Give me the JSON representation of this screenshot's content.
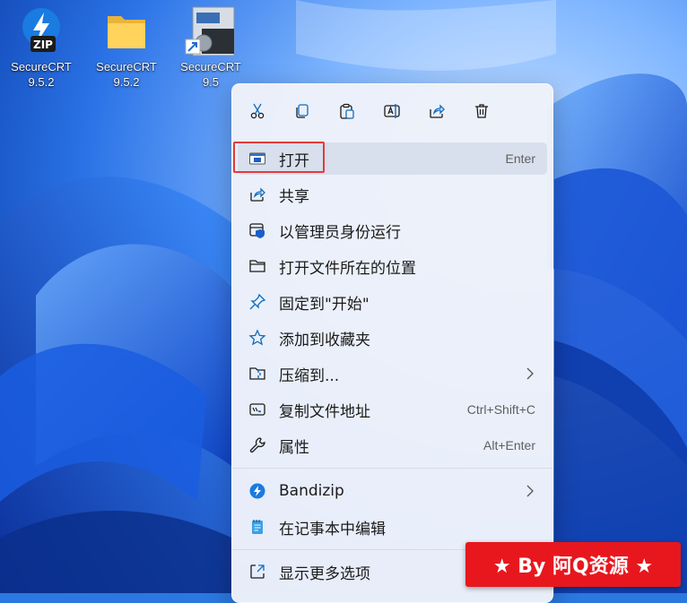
{
  "desktop": {
    "icons": [
      {
        "line1": "SecureCRT",
        "line2": "9.5.2",
        "icon": "zip-icon",
        "badge": "ZIP"
      },
      {
        "line1": "SecureCRT",
        "line2": "9.5.2",
        "icon": "folder-icon"
      },
      {
        "line1": "SecureCRT",
        "line2": "9.5",
        "icon": "securecrt-shortcut-icon"
      }
    ]
  },
  "context_menu": {
    "toolbar": [
      "cut-icon",
      "copy-icon",
      "paste-icon",
      "rename-icon",
      "share-icon",
      "delete-icon"
    ],
    "items": [
      {
        "label": "打开",
        "shortcut": "Enter",
        "icon": "open-window-icon"
      },
      {
        "label": "共享",
        "icon": "share-icon"
      },
      {
        "label": "以管理员身份运行",
        "icon": "admin-shield-icon"
      },
      {
        "label": "打开文件所在的位置",
        "icon": "folder-icon"
      },
      {
        "label": "固定到\"开始\"",
        "icon": "pin-icon"
      },
      {
        "label": "添加到收藏夹",
        "icon": "star-icon"
      },
      {
        "label": "压缩到...",
        "icon": "zip-folder-icon",
        "submenu": true
      },
      {
        "label": "复制文件地址",
        "shortcut": "Ctrl+Shift+C",
        "icon": "copy-path-icon"
      },
      {
        "label": "属性",
        "shortcut": "Alt+Enter",
        "icon": "wrench-icon"
      },
      {
        "label": "Bandizip",
        "icon": "bandizip-icon",
        "submenu": true
      },
      {
        "label": "在记事本中编辑",
        "icon": "notepad-icon"
      },
      {
        "label": "显示更多选项",
        "icon": "more-options-icon"
      }
    ]
  },
  "watermark": {
    "text": "★ By 阿Q资源 ★"
  },
  "colors": {
    "accent": "#0f6cbd",
    "highlight_border": "#e23b3b",
    "banner": "#e8171e"
  }
}
